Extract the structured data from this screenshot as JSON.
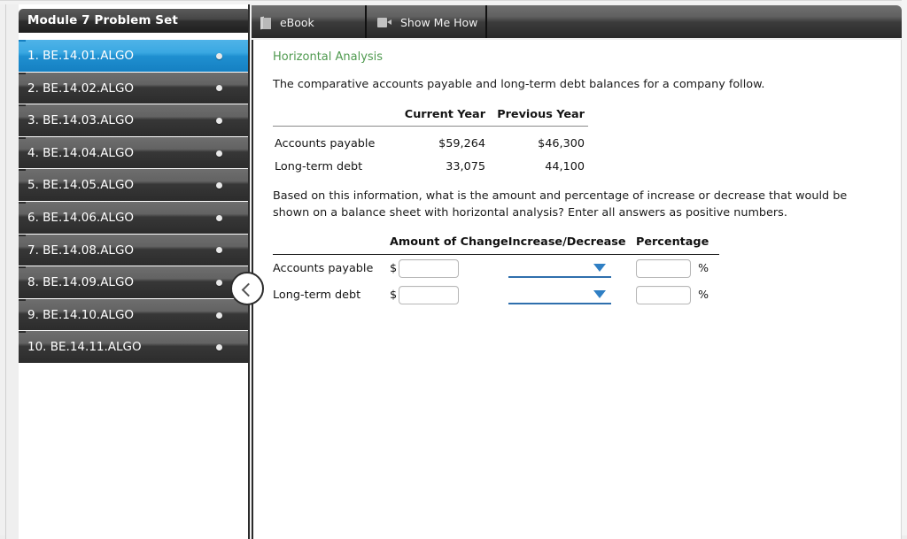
{
  "sidebar": {
    "title": "Module 7 Problem Set",
    "collapse_icon": "chevron-left-icon",
    "items": [
      {
        "label": "1. BE.14.01.ALGO",
        "selected": true
      },
      {
        "label": "2. BE.14.02.ALGO",
        "selected": false
      },
      {
        "label": "3. BE.14.03.ALGO",
        "selected": false
      },
      {
        "label": "4. BE.14.04.ALGO",
        "selected": false
      },
      {
        "label": "5. BE.14.05.ALGO",
        "selected": false
      },
      {
        "label": "6. BE.14.06.ALGO",
        "selected": false
      },
      {
        "label": "7. BE.14.08.ALGO",
        "selected": false
      },
      {
        "label": "8. BE.14.09.ALGO",
        "selected": false
      },
      {
        "label": "9. BE.14.10.ALGO",
        "selected": false
      },
      {
        "label": "10. BE.14.11.ALGO",
        "selected": false
      }
    ]
  },
  "tabs": [
    {
      "label": "eBook",
      "icon": "book-icon"
    },
    {
      "label": "Show Me How",
      "icon": "video-camera-icon"
    }
  ],
  "main": {
    "section_title": "Horizontal Analysis",
    "intro": "The comparative accounts payable and long-term debt balances for a company follow.",
    "comparative_table": {
      "headers": [
        "",
        "Current Year",
        "Previous Year"
      ],
      "rows": [
        {
          "label": "Accounts payable",
          "current_year": "$59,264",
          "previous_year": "$46,300"
        },
        {
          "label": "Long-term debt",
          "current_year": "33,075",
          "previous_year": "44,100"
        }
      ]
    },
    "question": "Based on this information, what is the amount and percentage of increase or decrease that would be shown on a balance sheet with horizontal analysis? Enter all answers as positive numbers.",
    "answer_table": {
      "headers": [
        "",
        "Amount of Change",
        "Increase/Decrease",
        "Percentage"
      ],
      "rows": [
        {
          "label": "Accounts payable",
          "currency_symbol": "$",
          "amount_value": "",
          "amount_placeholder": "",
          "direction_value": "",
          "percentage_value": "",
          "percentage_placeholder": "",
          "percent_symbol": "%",
          "caret_icon": "chevron-down-icon"
        },
        {
          "label": "Long-term debt",
          "currency_symbol": "$",
          "amount_value": "",
          "amount_placeholder": "",
          "direction_value": "",
          "percentage_value": "",
          "percentage_placeholder": "",
          "percent_symbol": "%",
          "caret_icon": "chevron-down-icon"
        }
      ]
    }
  },
  "colors": {
    "selected_item": "#1f8fd0",
    "section_title": "#4f9a4f",
    "select_underline": "#2f6fad",
    "caret": "#2f7fc4",
    "header_dark": "#2e2e2e"
  }
}
